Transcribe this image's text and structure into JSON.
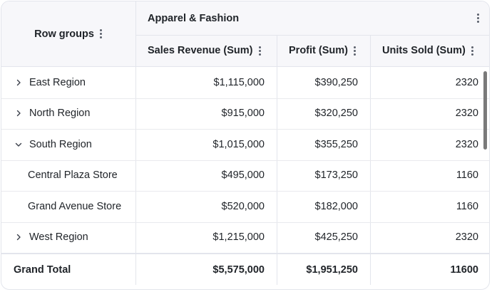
{
  "header": {
    "row_groups": "Row groups",
    "group_label": "Apparel & Fashion",
    "columns": [
      "Sales Revenue (Sum)",
      "Profit (Sum)",
      "Units Sold (Sum)"
    ]
  },
  "rows": [
    {
      "label": "East Region",
      "expandable": true,
      "expanded": false,
      "values": [
        "$1,115,000",
        "$390,250",
        "2320"
      ]
    },
    {
      "label": "North Region",
      "expandable": true,
      "expanded": false,
      "values": [
        "$915,000",
        "$320,250",
        "2320"
      ]
    },
    {
      "label": "South Region",
      "expandable": true,
      "expanded": true,
      "values": [
        "$1,015,000",
        "$355,250",
        "2320"
      ]
    },
    {
      "label": "Central Plaza Store",
      "expandable": false,
      "expanded": false,
      "values": [
        "$495,000",
        "$173,250",
        "1160"
      ]
    },
    {
      "label": "Grand Avenue Store",
      "expandable": false,
      "expanded": false,
      "values": [
        "$520,000",
        "$182,000",
        "1160"
      ]
    },
    {
      "label": "West Region",
      "expandable": true,
      "expanded": false,
      "values": [
        "$1,215,000",
        "$425,250",
        "2320"
      ]
    }
  ],
  "total": {
    "label": "Grand Total",
    "values": [
      "$5,575,000",
      "$1,951,250",
      "11600"
    ]
  },
  "icons": {
    "menu": "kebab-menu-icon",
    "collapsed": "chevron-right-icon",
    "expanded": "chevron-down-icon"
  },
  "colors": {
    "border": "#e3e5ec",
    "header_bg": "#f7f7fa",
    "text": "#1f2328",
    "scrollbar": "#7a7a7a"
  }
}
